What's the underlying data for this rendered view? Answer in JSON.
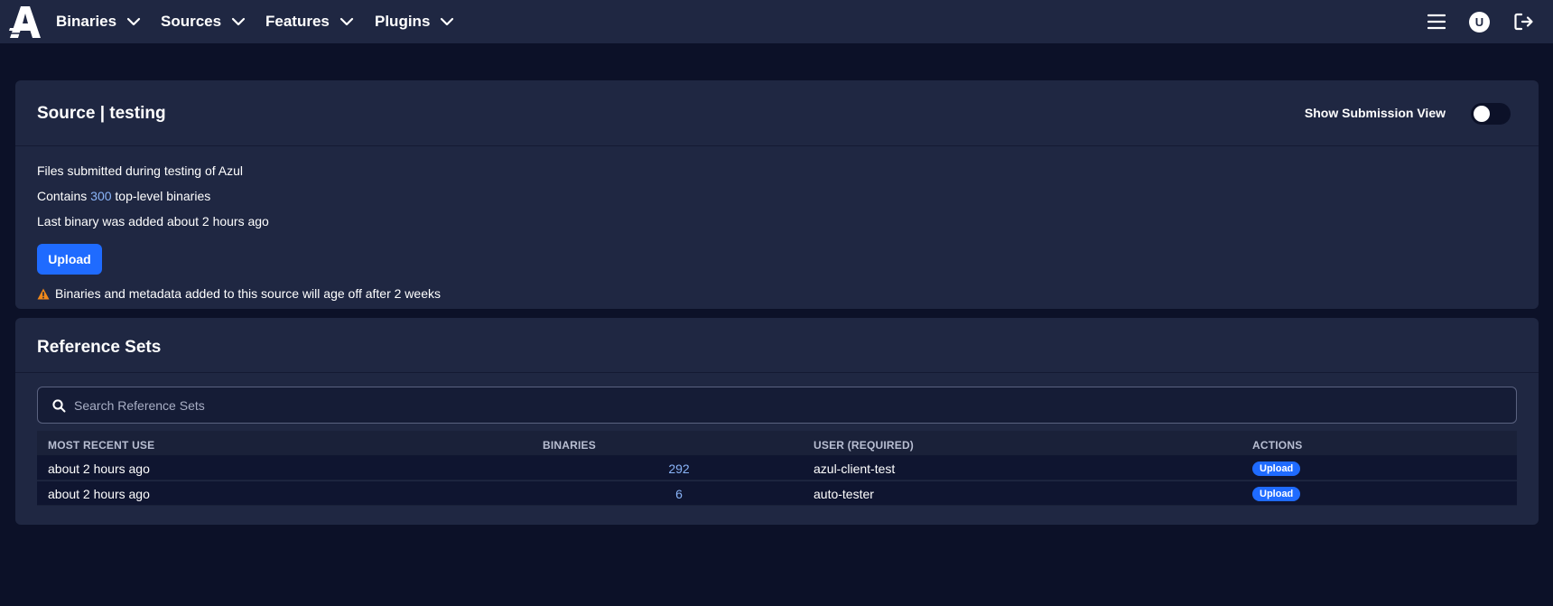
{
  "nav": {
    "items": [
      {
        "label": "Binaries"
      },
      {
        "label": "Sources"
      },
      {
        "label": "Features"
      },
      {
        "label": "Plugins"
      }
    ],
    "avatar_initial": "U"
  },
  "source_card": {
    "title": "Source | testing",
    "toggle_label": "Show Submission View",
    "toggle_on": false,
    "description": "Files submitted during testing of Azul",
    "contains_prefix": "Contains ",
    "binary_count": "300",
    "contains_suffix": " top-level binaries",
    "last_added": "Last binary was added about 2 hours ago",
    "upload_label": "Upload",
    "warning": "Binaries and metadata added to this source will age off after 2 weeks"
  },
  "reference_sets": {
    "title": "Reference Sets",
    "search_placeholder": "Search Reference Sets",
    "columns": [
      "MOST RECENT USE",
      "BINARIES",
      "USER (REQUIRED)",
      "ACTIONS"
    ],
    "rows": [
      {
        "recent": "about 2 hours ago",
        "binaries": "292",
        "user": "azul-client-test",
        "action": "Upload"
      },
      {
        "recent": "about 2 hours ago",
        "binaries": "6",
        "user": "auto-tester",
        "action": "Upload"
      }
    ]
  },
  "colors": {
    "background": "#0c1128",
    "panel": "#1f2742",
    "accent": "#1f6bff",
    "link": "#8ab4f8",
    "warning": "#f0891a"
  }
}
